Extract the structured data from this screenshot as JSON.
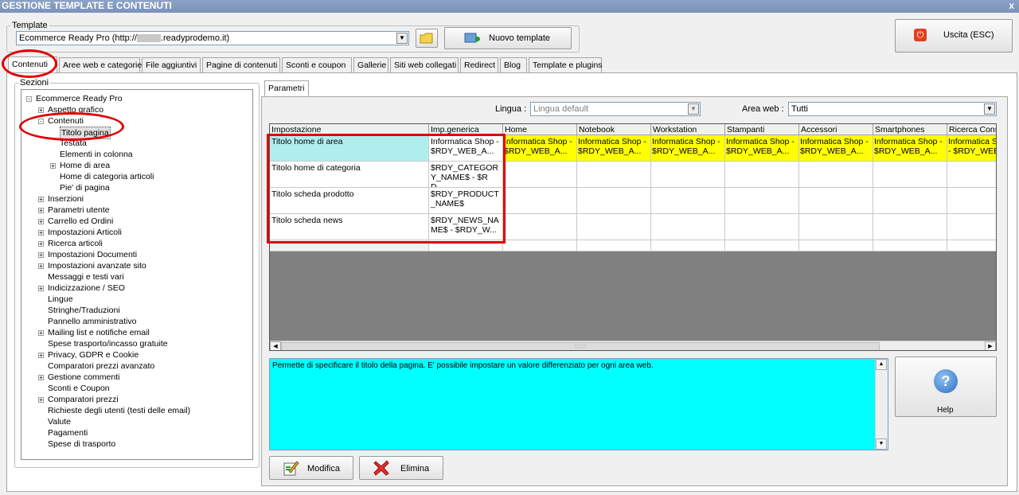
{
  "window": {
    "title": "GESTIONE TEMPLATE E CONTENUTI",
    "close": "x"
  },
  "template": {
    "legend": "Template",
    "selected": "Ecommerce Ready Pro (http://",
    "selected_suffix": ".readyprodemo.it)",
    "new_button": "Nuovo template"
  },
  "exit_button": "Uscita (ESC)",
  "tabs": [
    "Contenuti",
    "Aree web e categorie",
    "File aggiuntivi",
    "Pagine di contenuti",
    "Sconti e coupon",
    "Gallerie",
    "Siti web collegati",
    "Redirect",
    "Blog",
    "Template e plugins"
  ],
  "sections": {
    "legend": "Sezioni",
    "tree": [
      {
        "label": "Ecommerce Ready Pro",
        "level": 0,
        "exp": "-"
      },
      {
        "label": "Aspetto grafico",
        "level": 1,
        "exp": "+"
      },
      {
        "label": "Contenuti",
        "level": 1,
        "exp": "-"
      },
      {
        "label": "Titolo pagina",
        "level": 2,
        "exp": "",
        "selected": true
      },
      {
        "label": "Testata",
        "level": 2,
        "exp": ""
      },
      {
        "label": "Elementi in colonna",
        "level": 2,
        "exp": ""
      },
      {
        "label": "Home di area",
        "level": 2,
        "exp": "+"
      },
      {
        "label": "Home di categoria articoli",
        "level": 2,
        "exp": ""
      },
      {
        "label": "Pie' di pagina",
        "level": 2,
        "exp": ""
      },
      {
        "label": "Inserzioni",
        "level": 1,
        "exp": "+"
      },
      {
        "label": "Parametri utente",
        "level": 1,
        "exp": "+"
      },
      {
        "label": "Carrello ed Ordini",
        "level": 1,
        "exp": "+"
      },
      {
        "label": "Impostazioni Articoli",
        "level": 1,
        "exp": "+"
      },
      {
        "label": "Ricerca articoli",
        "level": 1,
        "exp": "+"
      },
      {
        "label": "Impostazioni Documenti",
        "level": 1,
        "exp": "+"
      },
      {
        "label": "Impostazioni avanzate sito",
        "level": 1,
        "exp": "+"
      },
      {
        "label": "Messaggi e testi vari",
        "level": 1,
        "exp": ""
      },
      {
        "label": "Indicizzazione / SEO",
        "level": 1,
        "exp": "+"
      },
      {
        "label": "Lingue",
        "level": 1,
        "exp": ""
      },
      {
        "label": "Stringhe/Traduzioni",
        "level": 1,
        "exp": ""
      },
      {
        "label": "Pannello amministrativo",
        "level": 1,
        "exp": ""
      },
      {
        "label": "Mailing list e notifiche email",
        "level": 1,
        "exp": "+"
      },
      {
        "label": "Spese trasporto/incasso gratuite",
        "level": 1,
        "exp": ""
      },
      {
        "label": "Privacy, GDPR e Cookie",
        "level": 1,
        "exp": "+"
      },
      {
        "label": "Comparatori prezzi avanzato",
        "level": 1,
        "exp": ""
      },
      {
        "label": "Gestione commenti",
        "level": 1,
        "exp": "+"
      },
      {
        "label": "Sconti e Coupon",
        "level": 1,
        "exp": ""
      },
      {
        "label": "Comparatori prezzi",
        "level": 1,
        "exp": "+"
      },
      {
        "label": "Richieste degli utenti (testi delle email)",
        "level": 1,
        "exp": ""
      },
      {
        "label": "Valute",
        "level": 1,
        "exp": ""
      },
      {
        "label": "Pagamenti",
        "level": 1,
        "exp": ""
      },
      {
        "label": "Spese di trasporto",
        "level": 1,
        "exp": ""
      }
    ]
  },
  "params": {
    "tab": "Parametri",
    "lingua_label": "Lingua :",
    "lingua_value": "Lingua default",
    "area_label": "Area web :",
    "area_value": "Tutti"
  },
  "grid": {
    "headers": [
      "Impostazione",
      "Imp.generica",
      "Home",
      "Notebook",
      "Workstation",
      "Stampanti",
      "Accessori",
      "Smartphones",
      "Ricerca Cons"
    ],
    "rows": [
      {
        "name": "Titolo home di area",
        "generic": "Informatica Shop - $RDY_WEB_A...",
        "cells": [
          "Informatica Shop - $RDY_WEB_A...",
          "Informatica Shop - $RDY_WEB_A...",
          "Informatica Shop - $RDY_WEB_A...",
          "Informatica Shop - $RDY_WEB_A...",
          "Informatica Shop - $RDY_WEB_A...",
          "Informatica Shop - $RDY_WEB_A...",
          "Informatica S - $RDY_WEB"
        ]
      },
      {
        "name": "Titolo home di categoria",
        "generic": "$RDY_CATEGORY_NAME$ - $RD...",
        "cells": [
          "",
          "",
          "",
          "",
          "",
          "",
          ""
        ]
      },
      {
        "name": "Titolo scheda prodotto",
        "generic": "$RDY_PRODUCT_NAME$",
        "cells": [
          "",
          "",
          "",
          "",
          "",
          "",
          ""
        ]
      },
      {
        "name": "Titolo scheda news",
        "generic": "$RDY_NEWS_NAME$ - $RDY_W...",
        "cells": [
          "",
          "",
          "",
          "",
          "",
          "",
          ""
        ]
      }
    ],
    "scroll_grip": "::::::::"
  },
  "description": "Permette di specificare il titolo della pagina. E' possibile impostare un valore differenziato per ogni area web.",
  "help_button": "Help",
  "edit_button": "Modifica",
  "delete_button": "Elimina"
}
